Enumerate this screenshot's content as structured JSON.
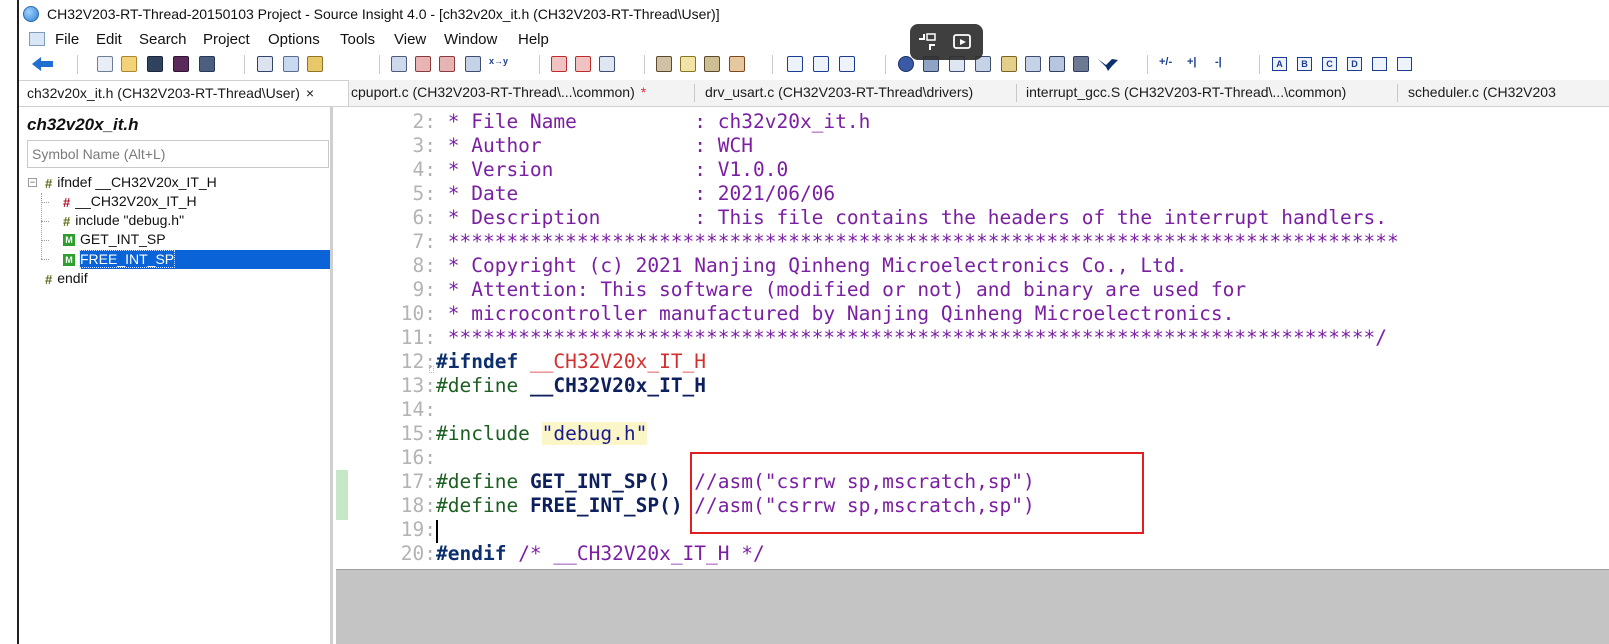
{
  "window": {
    "title": "CH32V203-RT-Thread-20150103 Project - Source Insight 4.0 - [ch32v20x_it.h (CH32V203-RT-Thread\\User)]"
  },
  "menu": [
    "File",
    "Edit",
    "Search",
    "Project",
    "Options",
    "Tools",
    "View",
    "Window",
    "Help"
  ],
  "toolbar": {
    "text_buttons": [
      "+/-",
      "+|",
      "-|"
    ],
    "box_buttons": [
      "A",
      "B",
      "C",
      "D",
      "",
      ""
    ]
  },
  "tabs": [
    {
      "label": "ch32v20x_it.h (CH32V203-RT-Thread\\User)",
      "close": "×",
      "active": true
    },
    {
      "label": "cpuport.c (CH32V203-RT-Thread\\...\\common)",
      "modified": "*"
    },
    {
      "label": "drv_usart.c (CH32V203-RT-Thread\\drivers)"
    },
    {
      "label": "interrupt_gcc.S (CH32V203-RT-Thread\\...\\common)"
    },
    {
      "label": "scheduler.c (CH32V203"
    }
  ],
  "symbol_panel": {
    "title": "ch32v20x_it.h",
    "search_placeholder": "Symbol Name (Alt+L)",
    "items": [
      {
        "label": "ifndef __CH32V20x_IT_H",
        "icon": "hash-icon"
      },
      {
        "label": "__CH32V20x_IT_H",
        "icon": "define-hash-icon"
      },
      {
        "label": "include \"debug.h\"",
        "icon": "hash-icon"
      },
      {
        "label": "GET_INT_SP",
        "icon": "macro-icon"
      },
      {
        "label": "FREE_INT_SP",
        "icon": "macro-icon",
        "selected": true
      },
      {
        "label": "endif",
        "icon": "hash-icon"
      }
    ]
  },
  "editor": {
    "lines": [
      {
        "n": "2:",
        "t": " * File Name          : ch32v20x_it.h"
      },
      {
        "n": "3:",
        "t": " * Author             : WCH"
      },
      {
        "n": "4:",
        "t": " * Version            : V1.0.0"
      },
      {
        "n": "5:",
        "t": " * Date               : 2021/06/06"
      },
      {
        "n": "6:",
        "t": " * Description        : This file contains the headers of the interrupt handlers."
      },
      {
        "n": "7:",
        "t": " *********************************************************************************"
      },
      {
        "n": "8:",
        "t": " * Copyright (c) 2021 Nanjing Qinheng Microelectronics Co., Ltd."
      },
      {
        "n": "9:",
        "t": " * Attention: This software (modified or not) and binary are used for"
      },
      {
        "n": "10:",
        "t": " * microcontroller manufactured by Nanjing Qinheng Microelectronics."
      },
      {
        "n": "11:",
        "t": " *******************************************************************************/"
      },
      {
        "n": "12:",
        "kw": "#ifndef",
        "id": "__CH32V20x_IT_H"
      },
      {
        "n": "13:",
        "kw": "#define",
        "id": "__CH32V20x_IT_H"
      },
      {
        "n": "14:"
      },
      {
        "n": "15:",
        "kw": "#include",
        "str": "\"debug.h\""
      },
      {
        "n": "16:"
      },
      {
        "n": "17:",
        "kw": "#define",
        "id": "GET_INT_SP()",
        "cm": "  //asm(\"csrrw sp,mscratch,sp\")"
      },
      {
        "n": "18:",
        "kw": "#define",
        "id": "FREE_INT_SP()",
        "cm": " //asm(\"csrrw sp,mscratch,sp\")"
      },
      {
        "n": "19:"
      },
      {
        "n": "20:",
        "kw": "#endif",
        "cm": " /* __CH32V20x_IT_H */"
      }
    ]
  },
  "colors": {
    "highlight_box": "#e02020",
    "selection": "#0a64d8",
    "comment": "#7b1fa2"
  }
}
